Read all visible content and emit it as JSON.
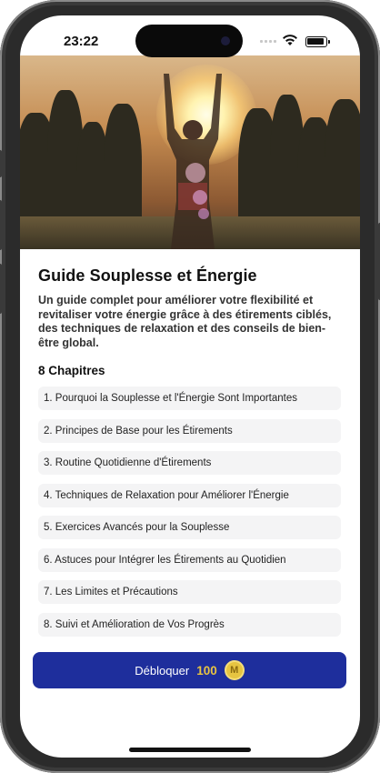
{
  "status_bar": {
    "time": "23:22"
  },
  "guide": {
    "title": "Guide Souplesse et Énergie",
    "description": "Un guide complet pour améliorer votre flexibilité et revitaliser votre énergie grâce à des étirements ciblés, des techniques de relaxation et des conseils de bien-être global.",
    "chapters_heading": "8 Chapitres",
    "chapters": [
      "1. Pourquoi la Souplesse et l'Énergie Sont Importantes",
      "2. Principes de Base pour les Étirements",
      "3. Routine Quotidienne d'Étirements",
      "4. Techniques de Relaxation pour Améliorer l'Énergie",
      "5. Exercices Avancés pour la Souplesse",
      "6. Astuces pour Intégrer les Étirements au Quotidien",
      "7. Les Limites et Précautions",
      "8. Suivi et Amélioration de Vos Progrès"
    ]
  },
  "unlock": {
    "label": "Débloquer",
    "price": "100",
    "coin_icon": "M"
  },
  "colors": {
    "accent": "#1e2e9c",
    "coin": "#e6c441"
  },
  "icons": [
    "signal-icon",
    "wifi-icon",
    "battery-icon",
    "coin-icon"
  ]
}
